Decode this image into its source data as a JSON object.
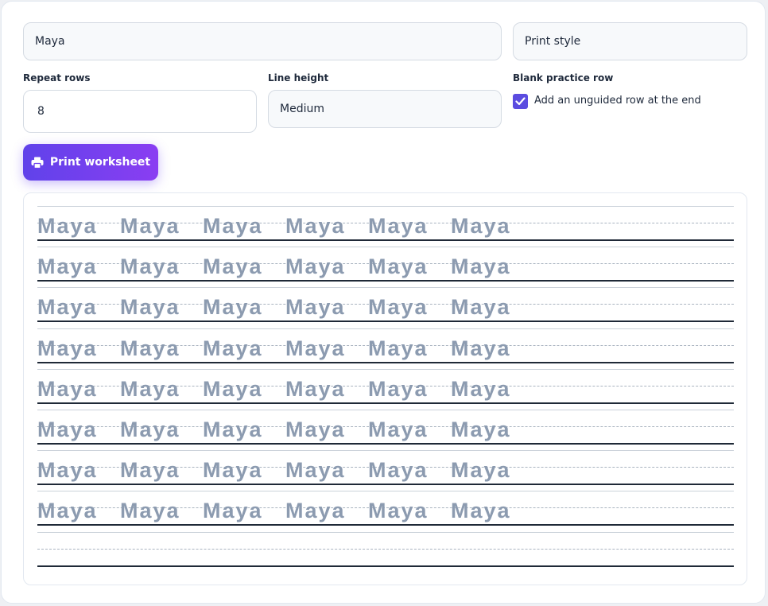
{
  "form": {
    "name_value": "Maya",
    "style_value": "Print style",
    "repeat_rows": {
      "label": "Repeat rows",
      "value": "8"
    },
    "line_height": {
      "label": "Line height",
      "value": "Medium"
    },
    "blank_row": {
      "label": "Blank practice row",
      "checkbox_label": "Add an unguided row at the end",
      "checked": true
    }
  },
  "print_button": {
    "label": "Print worksheet",
    "icon": "printer-icon"
  },
  "worksheet": {
    "rows": [
      [
        "Maya",
        "Maya",
        "Maya",
        "Maya",
        "Maya",
        "Maya"
      ],
      [
        "Maya",
        "Maya",
        "Maya",
        "Maya",
        "Maya",
        "Maya"
      ],
      [
        "Maya",
        "Maya",
        "Maya",
        "Maya",
        "Maya",
        "Maya"
      ],
      [
        "Maya",
        "Maya",
        "Maya",
        "Maya",
        "Maya",
        "Maya"
      ],
      [
        "Maya",
        "Maya",
        "Maya",
        "Maya",
        "Maya",
        "Maya"
      ],
      [
        "Maya",
        "Maya",
        "Maya",
        "Maya",
        "Maya",
        "Maya"
      ],
      [
        "Maya",
        "Maya",
        "Maya",
        "Maya",
        "Maya",
        "Maya"
      ],
      [
        "Maya",
        "Maya",
        "Maya",
        "Maya",
        "Maya",
        "Maya"
      ]
    ],
    "blank_row": true
  },
  "colors": {
    "accent": "#5b4ce0",
    "button_gradient_start": "#6042ea",
    "button_gradient_end": "#8a3ef2",
    "trace_text": "#8c9bb0",
    "baseline": "#1f2937"
  }
}
